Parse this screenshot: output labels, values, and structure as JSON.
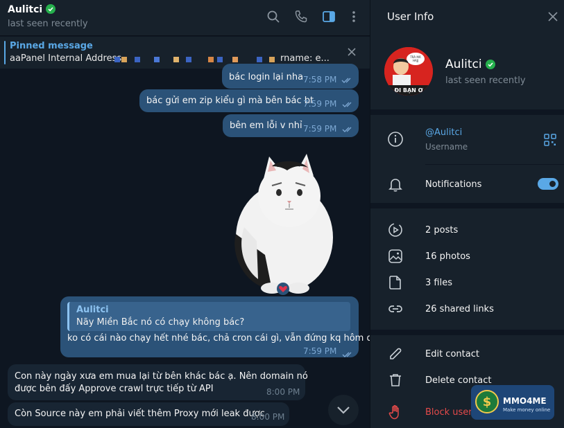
{
  "chat": {
    "name": "Aulitci",
    "status": "last seen recently",
    "pinned": {
      "title": "Pinned message",
      "text": "aaPanel Internal Address",
      "tail": "rname: e..."
    },
    "messages": [
      {
        "dir": "out",
        "text": "bác login lại nha",
        "time": "7:58 PM"
      },
      {
        "dir": "out",
        "text": "bác gửi em zip kiểu gì mà bên bác bt",
        "time": "7:59 PM"
      },
      {
        "dir": "out",
        "text": "bên em lỗi v nhỉ",
        "time": "7:59 PM"
      },
      {
        "dir": "out",
        "reply_name": "Aulitci",
        "reply_text": "Nãy Miền Bắc nó có chạy không bác?",
        "text": "ko có cái nào chạy hết nhé bác, chả cron cái gì, vẫn đứng kq hôm qua",
        "time": "7:59 PM"
      },
      {
        "dir": "in",
        "line1": "Con này ngày xưa em mua lại từ bên khác bác ạ. Nên domain nó",
        "line2": "được bên đấy Approve crawl trực tiếp từ API",
        "time": "8:00 PM"
      },
      {
        "dir": "in",
        "text": "Còn Source này em phải viết thêm Proxy mới leak được",
        "time": "8:00 PM"
      }
    ],
    "reaction": "heart"
  },
  "info": {
    "title": "User Info",
    "name": "Aulitci",
    "status": "last seen recently",
    "username": "@Aulitci",
    "username_label": "Username",
    "notifications_label": "Notifications",
    "notifications_on": true,
    "posts": "2 posts",
    "photos": "16 photos",
    "files": "3 files",
    "links": "26 shared links",
    "edit_contact": "Edit contact",
    "delete_contact": "Delete contact",
    "block_user": "Block user",
    "avatar_text_top": "TRÀ MÃ\nHAJJ",
    "avatar_text_bottom": "ĐI BẠN Ơ"
  },
  "watermark": {
    "brand": "MMO4ME",
    "tagline": "Make money online"
  },
  "colors": {
    "accent": "#5aa8e6",
    "outgoing_bubble": "#2b5278",
    "incoming_bubble": "#182533",
    "danger": "#e54a4a",
    "verified": "#26b04d"
  }
}
